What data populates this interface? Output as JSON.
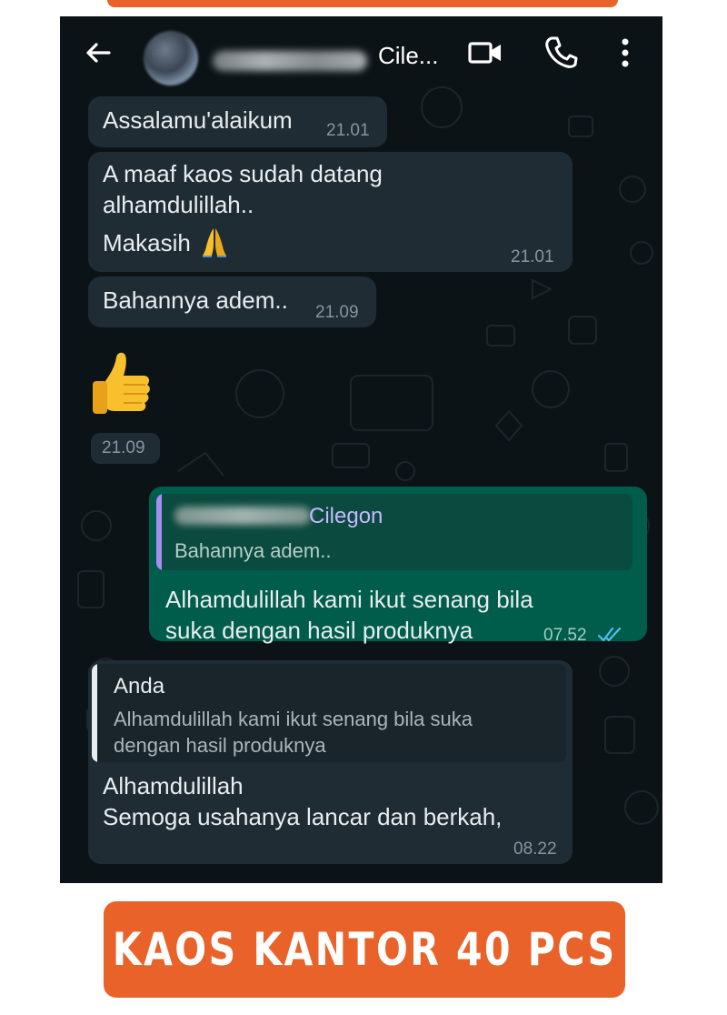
{
  "header": {
    "contact_name": "Cile...",
    "icons": [
      "back-arrow-icon",
      "avatar",
      "video-call-icon",
      "voice-call-icon",
      "more-options-icon"
    ]
  },
  "messages": [
    {
      "direction": "in",
      "text": "Assalamu'alaikum",
      "time": "21.01"
    },
    {
      "direction": "in",
      "lines": [
        "A maaf kaos sudah datang",
        "alhamdulillah..",
        "Makasih"
      ],
      "emoji": "folded-hands",
      "time": "21.01"
    },
    {
      "direction": "in",
      "text": "Bahannya adem..",
      "time": "21.09"
    },
    {
      "direction": "in",
      "emoji": "thumbs-up",
      "time": "21.09"
    },
    {
      "direction": "out",
      "quote_author": "Cilegon",
      "quote_text": "Bahannya adem..",
      "lines": [
        "Alhamdulillah kami ikut senang bila",
        "suka dengan hasil produknya"
      ],
      "time": "07.52",
      "status": "read-double-check"
    },
    {
      "direction": "in",
      "quote_author": "Anda",
      "quote_lines": [
        "Alhamdulillah kami ikut senang bila suka",
        "dengan hasil produknya"
      ],
      "lines": [
        "Alhamdulillah",
        "Semoga usahanya lancar dan berkah,"
      ],
      "time": "08.22"
    }
  ],
  "banner": {
    "text": "KAOS KANTOR 40 PCS"
  },
  "colors": {
    "chat_background": "#0c1317",
    "incoming_bubble": "#1f2c33",
    "outgoing_bubble": "#005c4b",
    "quote_accent_out": "#a68ef2",
    "read_ticks": "#53bdeb",
    "banner": "#e8622a"
  }
}
